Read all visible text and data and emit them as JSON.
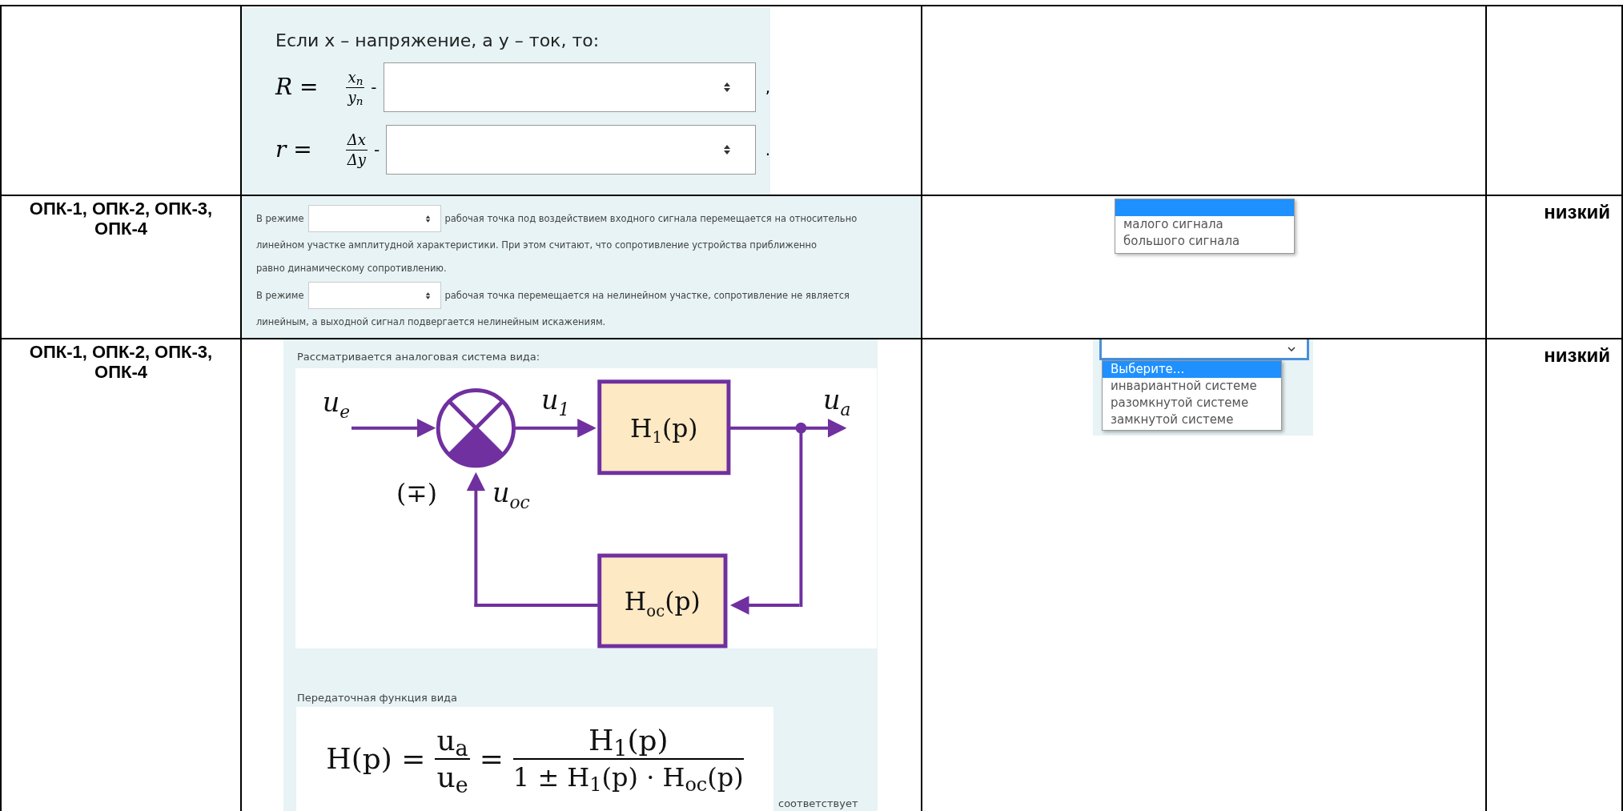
{
  "row_1": {
    "intro": "Если x – напряжение, а y –  ток, то:",
    "formulas": [
      {
        "lhs": "R =",
        "num": "x$_{п}$",
        "den": "y$_{п}$",
        "dash": "-",
        "end": ","
      },
      {
        "lhs": "r =",
        "num": "Δx",
        "den": "Δy",
        "dash": "-",
        "end": "."
      }
    ]
  },
  "row_2": {
    "competence": "ОПК-1, ОПК-2, ОПК-3, ОПК-4",
    "paragraphs": [
      {
        "before": "В режиме",
        "after": "рабочая точка под воздействием входного сигнала перемещается на относительно",
        "continuation": "линейном участке амплитудной характеристики. При этом считают, что сопротивление устройства приближенно равно динамическому сопротивлению."
      },
      {
        "before": "В режиме",
        "after": "рабочая точка перемещается на нелинейном участке, сопротивление не является",
        "continuation": "линейным, а выходной сигнал подвергается нелинейным искажениям."
      }
    ],
    "dropdown_options": [
      {
        "selected": true
      },
      {
        "label": "малого сигнала",
        "selected": false
      },
      {
        "label": "большого сигнала",
        "selected": false
      }
    ],
    "difficulty": "низкий"
  },
  "row_3": {
    "competence": "ОПК-1, ОПК-2, ОПК-3, ОПК-4",
    "intro": "Рассматривается аналоговая система вида:",
    "diagram": {
      "input": {
        "main": "u",
        "sub": "e"
      },
      "error": {
        "main": "u",
        "sub": "1"
      },
      "output": {
        "main": "u",
        "sub": "a"
      },
      "sign": "(∓)",
      "feedback": {
        "main": "u",
        "sub": "oc"
      },
      "forward_block": {
        "main": "H",
        "sub": "1",
        "tail": "(p)"
      },
      "feedback_block": {
        "main": "H",
        "sub": "oc",
        "tail": "(p)"
      }
    },
    "transfer_label": "Передаточная функция вида",
    "transfer": {
      "lhs": "H(p) =",
      "ratio_num": "u$_{a}$",
      "ratio_den": "u$_{e}$",
      "eq": "=",
      "num": "H$_{1}$(p)",
      "den": "1 ± H$_{1}$(p) · H$_{oc}$(p)"
    },
    "trailing": "соответствует",
    "dropdown_options": [
      {
        "label": "Выберите...",
        "selected": true
      },
      {
        "label": "инвариантной системе",
        "selected": false
      },
      {
        "label": "разомкнутой системе",
        "selected": false
      },
      {
        "label": "замкнутой системе",
        "selected": false
      }
    ],
    "difficulty": "низкий"
  }
}
